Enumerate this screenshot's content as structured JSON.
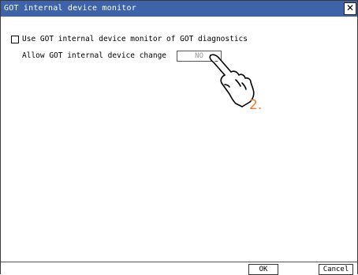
{
  "window": {
    "title": "GOT internal device monitor",
    "close_label": "✕"
  },
  "options": {
    "use_monitor_label": "Use GOT internal device monitor of GOT diagnostics",
    "use_monitor_checked": false,
    "allow_change_label": "Allow GOT internal device change",
    "allow_change_value": "NO"
  },
  "annotation": {
    "step": "2.",
    "color": "#f07c2a"
  },
  "buttons": {
    "ok": "OK",
    "cancel": "Cancel"
  },
  "colors": {
    "titlebar": "#3e63a8"
  }
}
